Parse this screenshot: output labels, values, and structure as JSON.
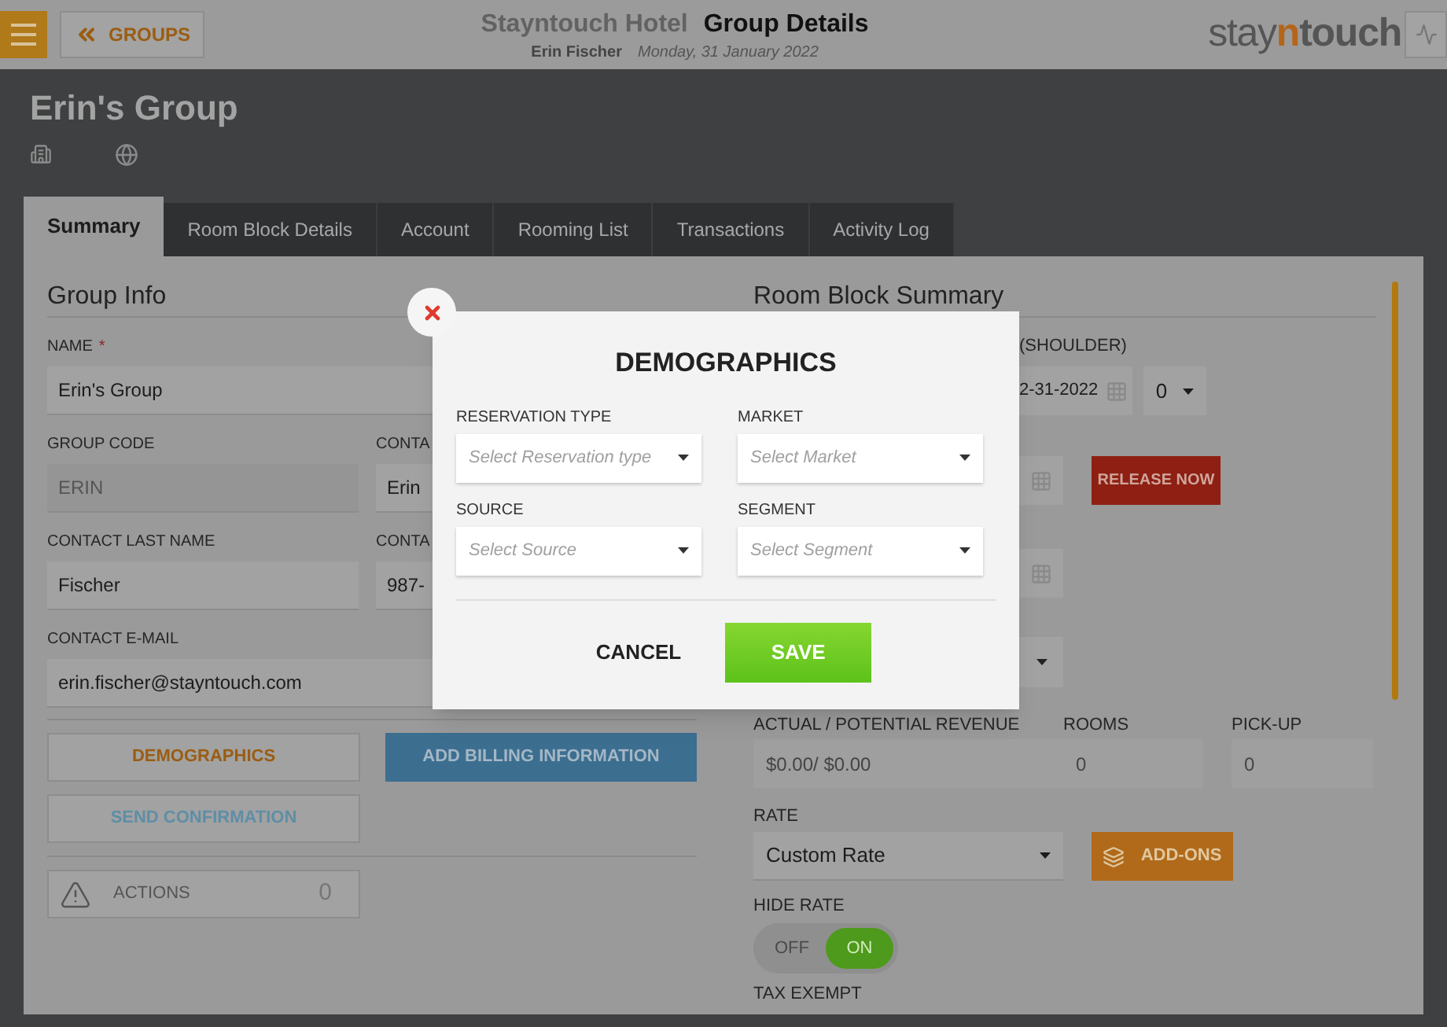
{
  "header": {
    "back_button": "GROUPS",
    "hotel_name": "Stayntouch Hotel",
    "page_title": "Group Details",
    "user": "Erin Fischer",
    "date": "Monday, 31 January 2022",
    "logo": [
      {
        "text": "stay",
        "kind": "light"
      },
      {
        "text": "n",
        "kind": "accent"
      },
      {
        "text": "touch",
        "kind": "bold"
      }
    ]
  },
  "group_name": "Erin's Group",
  "tabs": [
    {
      "label": "Summary",
      "selected": true
    },
    {
      "label": "Room Block Details",
      "selected": false
    },
    {
      "label": "Account",
      "selected": false
    },
    {
      "label": "Rooming List",
      "selected": false
    },
    {
      "label": "Transactions",
      "selected": false
    },
    {
      "label": "Activity Log",
      "selected": false
    }
  ],
  "group_info": {
    "title": "Group Info",
    "rows": [
      [
        {
          "label": "NAME",
          "required_mark": "*",
          "value": "Erin's Group",
          "disabled": false
        }
      ],
      [
        {
          "label": "GROUP CODE",
          "value": "ERIN",
          "disabled": true
        },
        {
          "label": "CONTA",
          "value": "Erin",
          "disabled": false
        }
      ],
      [
        {
          "label": "CONTACT LAST NAME",
          "value": "Fischer",
          "disabled": false
        },
        {
          "label": "CONTA",
          "value": "987-",
          "disabled": false
        }
      ],
      [
        {
          "label": "CONTACT E-MAIL",
          "value": "erin.fischer@stayntouch.com",
          "disabled": false
        }
      ]
    ],
    "demographics_button": "DEMOGRAPHICS",
    "billing_button": "ADD BILLING INFORMATION",
    "confirmation_button": "SEND CONFIRMATION",
    "actions": {
      "label": "ACTIONS",
      "count": "0"
    }
  },
  "room_block": {
    "title": "Room Block Summary",
    "shoulder_label": "(SHOULDER)",
    "shoulder_date": "2-31-2022",
    "shoulder_count": "0",
    "release_button": "RELEASE NOW",
    "stats": [
      {
        "label": "ACTUAL / POTENTIAL REVENUE",
        "value": "$0.00/ $0.00"
      },
      {
        "label": "ROOMS",
        "value": "0"
      },
      {
        "label": "PICK-UP",
        "value": "0"
      }
    ],
    "rate": {
      "label": "RATE",
      "value": "Custom Rate"
    },
    "addons_button": "ADD-ONS",
    "hide_rate": {
      "label": "HIDE RATE",
      "off_label": "OFF",
      "on_label": "ON",
      "on": true
    },
    "tax_exempt_label": "TAX EXEMPT"
  },
  "modal": {
    "title": "DEMOGRAPHICS",
    "selects": [
      {
        "label": "RESERVATION TYPE",
        "placeholder": "Select Reservation type"
      },
      {
        "label": "MARKET",
        "placeholder": "Select Market"
      },
      {
        "label": "SOURCE",
        "placeholder": "Select Source"
      },
      {
        "label": "SEGMENT",
        "placeholder": "Select Segment"
      }
    ],
    "cancel": "CANCEL",
    "save": "SAVE"
  }
}
